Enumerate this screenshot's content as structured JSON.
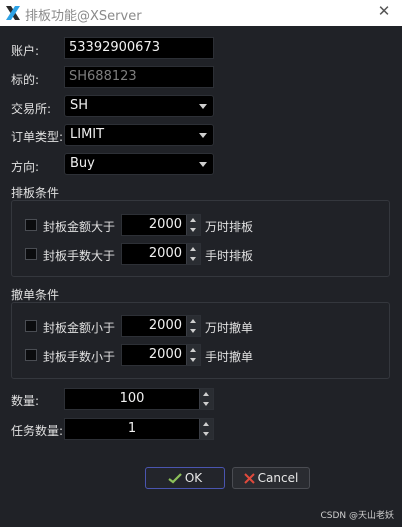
{
  "window": {
    "title": "排板功能@XServer",
    "icon": "x-app-icon",
    "close_icon": "close-icon"
  },
  "form": {
    "account": {
      "label": "账户:",
      "value": "53392900673"
    },
    "symbol": {
      "label": "标的:",
      "value": "SH688123"
    },
    "exchange": {
      "label": "交易所:",
      "value": "SH"
    },
    "order_type": {
      "label": "订单类型:",
      "value": "LIMIT"
    },
    "direction": {
      "label": "方向:",
      "value": "Buy"
    }
  },
  "queue_conditions": {
    "title": "排板条件",
    "rows": [
      {
        "prefix": "封板金额大于",
        "value": "2000",
        "suffix": "万时排板",
        "checked": false
      },
      {
        "prefix": "封板手数大于",
        "value": "2000",
        "suffix": "手时排板",
        "checked": false
      }
    ]
  },
  "cancel_conditions": {
    "title": "撤单条件",
    "rows": [
      {
        "prefix": "封板金额小于",
        "value": "2000",
        "suffix": "万时撤单",
        "checked": false
      },
      {
        "prefix": "封板手数小于",
        "value": "2000",
        "suffix": "手时撤单",
        "checked": false
      }
    ]
  },
  "quantity": {
    "label": "数量:",
    "value": "100"
  },
  "task_count": {
    "label": "任务数量:",
    "value": "1"
  },
  "buttons": {
    "ok": "OK",
    "cancel": "Cancel"
  },
  "watermark": "CSDN @天山老妖"
}
